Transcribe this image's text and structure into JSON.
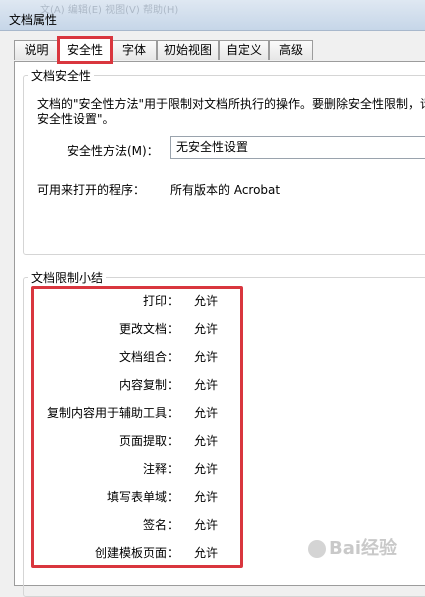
{
  "window": {
    "title": "文档属性",
    "background_menu_text": "文(A)  编辑(E)  视图(V)  帮助(H)"
  },
  "tabs": [
    {
      "label": "说明",
      "active": false
    },
    {
      "label": "安全性",
      "active": true
    },
    {
      "label": "字体",
      "active": false
    },
    {
      "label": "初始视图",
      "active": false
    },
    {
      "label": "自定义",
      "active": false
    },
    {
      "label": "高级",
      "active": false
    }
  ],
  "security": {
    "group_title": "文档安全性",
    "description_line1": "文档的\"安全性方法\"用于限制对文档所执行的操作。要删除安全性限制，请",
    "description_line2": "安全性设置\"。",
    "method_label": "安全性方法(M)：",
    "method_value": "无安全性设置",
    "open_label": "可用来打开的程序：",
    "open_value": "所有版本的 Acrobat"
  },
  "restrictions": {
    "group_title": "文档限制小结",
    "items": [
      {
        "label": "打印：",
        "value": "允许"
      },
      {
        "label": "更改文档：",
        "value": "允许"
      },
      {
        "label": "文档组合：",
        "value": "允许"
      },
      {
        "label": "内容复制：",
        "value": "允许"
      },
      {
        "label": "复制内容用于辅助工具：",
        "value": "允许"
      },
      {
        "label": "页面提取：",
        "value": "允许"
      },
      {
        "label": "注释：",
        "value": "允许"
      },
      {
        "label": "填写表单域：",
        "value": "允许"
      },
      {
        "label": "签名：",
        "value": "允许"
      },
      {
        "label": "创建模板页面：",
        "value": "允许"
      }
    ]
  },
  "watermark": {
    "text": "Bai经验"
  },
  "colors": {
    "highlight": "#d9363e",
    "panel": "#ffffff",
    "dialog": "#f0f0f0"
  }
}
